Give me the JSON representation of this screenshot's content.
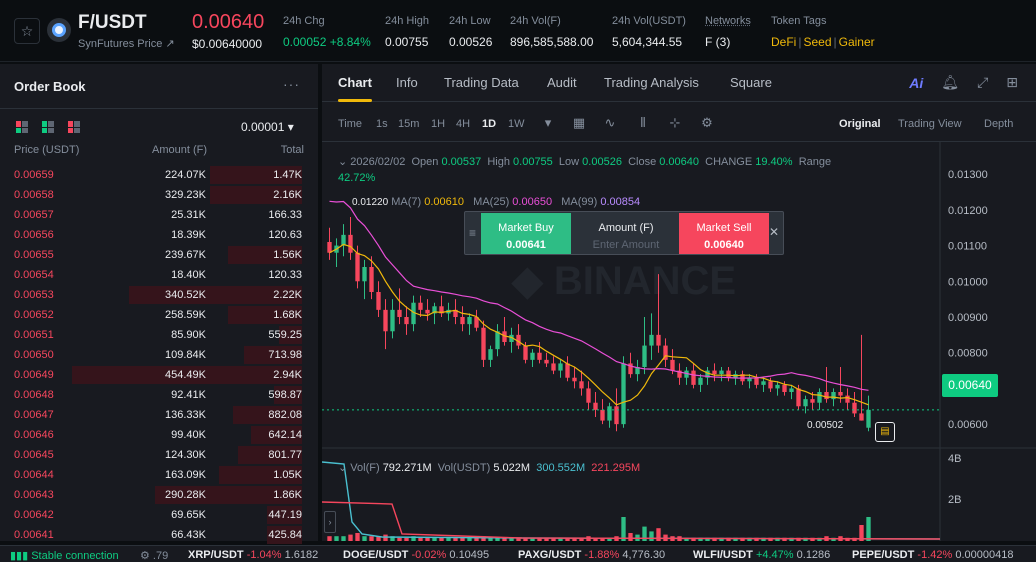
{
  "header": {
    "pair": "F/USDT",
    "source": "SynFutures Price ↗",
    "last_price": "0.00640",
    "last_price_usd": "$0.00640000",
    "stats": [
      {
        "label": "24h Chg",
        "value": "0.00052 +8.84%",
        "color": "green"
      },
      {
        "label": "24h High",
        "value": "0.00755"
      },
      {
        "label": "24h Low",
        "value": "0.00526"
      },
      {
        "label": "24h Vol(F)",
        "value": "896,585,588.00"
      },
      {
        "label": "24h Vol(USDT)",
        "value": "5,604,344.55"
      },
      {
        "label": "Networks",
        "value": "F (3)"
      }
    ],
    "token_tags_label": "Token Tags",
    "token_tags": [
      "DeFi",
      "Seed",
      "Gainer"
    ]
  },
  "orderbook": {
    "title": "Order Book",
    "precision": "0.00001 ▾",
    "col_price": "Price (USDT)",
    "col_amount": "Amount (F)",
    "col_total": "Total",
    "rows": [
      {
        "price": "0.00659",
        "amount": "224.07K",
        "total": "1.47K",
        "depth": 0.4
      },
      {
        "price": "0.00658",
        "amount": "329.23K",
        "total": "2.16K",
        "depth": 0.4
      },
      {
        "price": "0.00657",
        "amount": "25.31K",
        "total": "166.33",
        "depth": 0.0
      },
      {
        "price": "0.00656",
        "amount": "18.39K",
        "total": "120.63",
        "depth": 0.0
      },
      {
        "price": "0.00655",
        "amount": "239.67K",
        "total": "1.56K",
        "depth": 0.32
      },
      {
        "price": "0.00654",
        "amount": "18.40K",
        "total": "120.33",
        "depth": 0.0
      },
      {
        "price": "0.00653",
        "amount": "340.52K",
        "total": "2.22K",
        "depth": 0.75
      },
      {
        "price": "0.00652",
        "amount": "258.59K",
        "total": "1.68K",
        "depth": 0.32
      },
      {
        "price": "0.00651",
        "amount": "85.90K",
        "total": "559.25",
        "depth": 0.1
      },
      {
        "price": "0.00650",
        "amount": "109.84K",
        "total": "713.98",
        "depth": 0.25
      },
      {
        "price": "0.00649",
        "amount": "454.49K",
        "total": "2.94K",
        "depth": 1.0
      },
      {
        "price": "0.00648",
        "amount": "92.41K",
        "total": "598.87",
        "depth": 0.12
      },
      {
        "price": "0.00647",
        "amount": "136.33K",
        "total": "882.08",
        "depth": 0.3
      },
      {
        "price": "0.00646",
        "amount": "99.40K",
        "total": "642.14",
        "depth": 0.22
      },
      {
        "price": "0.00645",
        "amount": "124.30K",
        "total": "801.77",
        "depth": 0.28
      },
      {
        "price": "0.00644",
        "amount": "163.09K",
        "total": "1.05K",
        "depth": 0.36
      },
      {
        "price": "0.00643",
        "amount": "290.28K",
        "total": "1.86K",
        "depth": 0.64
      },
      {
        "price": "0.00642",
        "amount": "69.65K",
        "total": "447.19",
        "depth": 0.15
      },
      {
        "price": "0.00641",
        "amount": "66.43K",
        "total": "425.84",
        "depth": 0.15
      }
    ]
  },
  "chart_tabs": [
    "Chart",
    "Info",
    "Trading Data",
    "Audit",
    "Trading Analysis",
    "Square"
  ],
  "timeframes": [
    "Time",
    "1s",
    "15m",
    "1H",
    "4H",
    "1D",
    "1W"
  ],
  "active_timeframe": "1D",
  "view_modes": [
    "Original",
    "Trading View",
    "Depth"
  ],
  "ohlc": {
    "date": "2026/02/02",
    "open_label": "Open",
    "open": "0.00537",
    "high_label": "High",
    "high": "0.00755",
    "low_label": "Low",
    "low": "0.00526",
    "close_label": "Close",
    "close": "0.00640",
    "change_label": "CHANGE",
    "change": "19.40%",
    "range_label": "Range",
    "range": "42.72%"
  },
  "ma": {
    "ma7_label": "MA(7)",
    "ma7": "0.00610",
    "ma25_label": "MA(25)",
    "ma25": "0.00650",
    "ma99_label": "MA(99)",
    "ma99": "0.00854",
    "cursor_price": "0.01220"
  },
  "trade_popup": {
    "buy_label": "Market Buy",
    "buy_price": "0.00641",
    "amount_label": "Amount (F)",
    "amount_placeholder": "Enter Amount",
    "sell_label": "Market Sell",
    "sell_price": "0.00640"
  },
  "watermark": "BINANCE",
  "price_tag": "0.00640",
  "low_marker": "0.00502",
  "volume": {
    "vol_label": "Vol(F)",
    "vol_value": "792.271M",
    "usdt_label": "Vol(USDT)",
    "usdt_value": "5.022M",
    "ma1": "300.552M",
    "ma2": "221.295M"
  },
  "chart_data": {
    "type": "candlestick",
    "y_ticks": [
      "0.01300",
      "0.01200",
      "0.01100",
      "0.01000",
      "0.00900",
      "0.00800",
      "0.00700",
      "0.00600"
    ],
    "ylim": [
      0.0055,
      0.0139
    ],
    "vol_ticks": [
      "4B",
      "2B"
    ],
    "candles": [
      {
        "o": 0.0111,
        "h": 0.0115,
        "l": 0.0106,
        "c": 0.0108
      },
      {
        "o": 0.0108,
        "h": 0.0112,
        "l": 0.0104,
        "c": 0.011
      },
      {
        "o": 0.011,
        "h": 0.0116,
        "l": 0.0107,
        "c": 0.0113
      },
      {
        "o": 0.0113,
        "h": 0.0118,
        "l": 0.0106,
        "c": 0.0108
      },
      {
        "o": 0.0108,
        "h": 0.011,
        "l": 0.0098,
        "c": 0.01
      },
      {
        "o": 0.01,
        "h": 0.0106,
        "l": 0.0095,
        "c": 0.0104
      },
      {
        "o": 0.0104,
        "h": 0.0107,
        "l": 0.0095,
        "c": 0.0097
      },
      {
        "o": 0.0097,
        "h": 0.01,
        "l": 0.009,
        "c": 0.0092
      },
      {
        "o": 0.0092,
        "h": 0.0095,
        "l": 0.0081,
        "c": 0.0086
      },
      {
        "o": 0.0086,
        "h": 0.0095,
        "l": 0.0084,
        "c": 0.0092
      },
      {
        "o": 0.0092,
        "h": 0.0098,
        "l": 0.0088,
        "c": 0.009
      },
      {
        "o": 0.009,
        "h": 0.0093,
        "l": 0.0085,
        "c": 0.0088
      },
      {
        "o": 0.0088,
        "h": 0.0096,
        "l": 0.0086,
        "c": 0.0094
      },
      {
        "o": 0.0094,
        "h": 0.0096,
        "l": 0.009,
        "c": 0.0092
      },
      {
        "o": 0.0092,
        "h": 0.0095,
        "l": 0.0089,
        "c": 0.0091
      },
      {
        "o": 0.0091,
        "h": 0.0094,
        "l": 0.0088,
        "c": 0.0093
      },
      {
        "o": 0.0093,
        "h": 0.0096,
        "l": 0.009,
        "c": 0.0091
      },
      {
        "o": 0.0091,
        "h": 0.0094,
        "l": 0.0089,
        "c": 0.0092
      },
      {
        "o": 0.0092,
        "h": 0.0095,
        "l": 0.0088,
        "c": 0.009
      },
      {
        "o": 0.009,
        "h": 0.0093,
        "l": 0.0086,
        "c": 0.0088
      },
      {
        "o": 0.0088,
        "h": 0.0091,
        "l": 0.0085,
        "c": 0.009
      },
      {
        "o": 0.009,
        "h": 0.0092,
        "l": 0.0086,
        "c": 0.0087
      },
      {
        "o": 0.0087,
        "h": 0.0089,
        "l": 0.0076,
        "c": 0.0078
      },
      {
        "o": 0.0078,
        "h": 0.0082,
        "l": 0.0076,
        "c": 0.0081
      },
      {
        "o": 0.0081,
        "h": 0.0088,
        "l": 0.0079,
        "c": 0.0086
      },
      {
        "o": 0.0086,
        "h": 0.009,
        "l": 0.0082,
        "c": 0.0083
      },
      {
        "o": 0.0083,
        "h": 0.0087,
        "l": 0.008,
        "c": 0.0085
      },
      {
        "o": 0.0085,
        "h": 0.0088,
        "l": 0.0081,
        "c": 0.0082
      },
      {
        "o": 0.0082,
        "h": 0.0083,
        "l": 0.0077,
        "c": 0.0078
      },
      {
        "o": 0.0078,
        "h": 0.0081,
        "l": 0.0076,
        "c": 0.008
      },
      {
        "o": 0.008,
        "h": 0.0083,
        "l": 0.0077,
        "c": 0.0078
      },
      {
        "o": 0.0078,
        "h": 0.008,
        "l": 0.0076,
        "c": 0.0077
      },
      {
        "o": 0.0077,
        "h": 0.0079,
        "l": 0.0074,
        "c": 0.0075
      },
      {
        "o": 0.0075,
        "h": 0.0078,
        "l": 0.0073,
        "c": 0.0077
      },
      {
        "o": 0.0077,
        "h": 0.0079,
        "l": 0.0072,
        "c": 0.0073
      },
      {
        "o": 0.0073,
        "h": 0.0076,
        "l": 0.007,
        "c": 0.0072
      },
      {
        "o": 0.0072,
        "h": 0.0075,
        "l": 0.0068,
        "c": 0.007
      },
      {
        "o": 0.007,
        "h": 0.0072,
        "l": 0.0064,
        "c": 0.0066
      },
      {
        "o": 0.0066,
        "h": 0.0069,
        "l": 0.0062,
        "c": 0.0064
      },
      {
        "o": 0.0064,
        "h": 0.0067,
        "l": 0.006,
        "c": 0.0061
      },
      {
        "o": 0.0061,
        "h": 0.0066,
        "l": 0.0059,
        "c": 0.0065
      },
      {
        "o": 0.0065,
        "h": 0.007,
        "l": 0.0058,
        "c": 0.006
      },
      {
        "o": 0.006,
        "h": 0.0079,
        "l": 0.0059,
        "c": 0.0077
      },
      {
        "o": 0.0077,
        "h": 0.008,
        "l": 0.0073,
        "c": 0.0074
      },
      {
        "o": 0.0074,
        "h": 0.0078,
        "l": 0.0072,
        "c": 0.0076
      },
      {
        "o": 0.0076,
        "h": 0.009,
        "l": 0.0074,
        "c": 0.0082
      },
      {
        "o": 0.0082,
        "h": 0.0091,
        "l": 0.0078,
        "c": 0.0085
      },
      {
        "o": 0.0085,
        "h": 0.0102,
        "l": 0.008,
        "c": 0.0082
      },
      {
        "o": 0.0082,
        "h": 0.0084,
        "l": 0.0076,
        "c": 0.0078
      },
      {
        "o": 0.0078,
        "h": 0.0081,
        "l": 0.0074,
        "c": 0.0075
      },
      {
        "o": 0.0075,
        "h": 0.0077,
        "l": 0.0071,
        "c": 0.0073
      },
      {
        "o": 0.0073,
        "h": 0.0076,
        "l": 0.0071,
        "c": 0.0075
      },
      {
        "o": 0.0075,
        "h": 0.0077,
        "l": 0.007,
        "c": 0.0071
      },
      {
        "o": 0.0071,
        "h": 0.0074,
        "l": 0.0069,
        "c": 0.0073
      },
      {
        "o": 0.0073,
        "h": 0.0076,
        "l": 0.0071,
        "c": 0.0075
      },
      {
        "o": 0.0075,
        "h": 0.0077,
        "l": 0.0072,
        "c": 0.0074
      },
      {
        "o": 0.0074,
        "h": 0.0076,
        "l": 0.0072,
        "c": 0.0075
      },
      {
        "o": 0.0075,
        "h": 0.0076,
        "l": 0.0072,
        "c": 0.0073
      },
      {
        "o": 0.0073,
        "h": 0.0075,
        "l": 0.0071,
        "c": 0.0074
      },
      {
        "o": 0.0074,
        "h": 0.0075,
        "l": 0.0071,
        "c": 0.0072
      },
      {
        "o": 0.0072,
        "h": 0.0074,
        "l": 0.007,
        "c": 0.0073
      },
      {
        "o": 0.0073,
        "h": 0.0074,
        "l": 0.007,
        "c": 0.0071
      },
      {
        "o": 0.0071,
        "h": 0.0073,
        "l": 0.0069,
        "c": 0.0072
      },
      {
        "o": 0.0072,
        "h": 0.0073,
        "l": 0.0069,
        "c": 0.007
      },
      {
        "o": 0.007,
        "h": 0.0072,
        "l": 0.0068,
        "c": 0.0071
      },
      {
        "o": 0.0071,
        "h": 0.0072,
        "l": 0.0068,
        "c": 0.0069
      },
      {
        "o": 0.0069,
        "h": 0.0071,
        "l": 0.0067,
        "c": 0.007
      },
      {
        "o": 0.007,
        "h": 0.0071,
        "l": 0.0064,
        "c": 0.0065
      },
      {
        "o": 0.0065,
        "h": 0.0068,
        "l": 0.0063,
        "c": 0.0067
      },
      {
        "o": 0.0067,
        "h": 0.0069,
        "l": 0.0064,
        "c": 0.0066
      },
      {
        "o": 0.0066,
        "h": 0.007,
        "l": 0.0064,
        "c": 0.0069
      },
      {
        "o": 0.0069,
        "h": 0.0076,
        "l": 0.0066,
        "c": 0.0067
      },
      {
        "o": 0.0067,
        "h": 0.007,
        "l": 0.0065,
        "c": 0.0069
      },
      {
        "o": 0.0069,
        "h": 0.0076,
        "l": 0.0066,
        "c": 0.0068
      },
      {
        "o": 0.0068,
        "h": 0.007,
        "l": 0.0064,
        "c": 0.0066
      },
      {
        "o": 0.0066,
        "h": 0.0069,
        "l": 0.0062,
        "c": 0.0063
      },
      {
        "o": 0.0063,
        "h": 0.0085,
        "l": 0.0061,
        "c": 0.0061
      },
      {
        "o": 0.0059,
        "h": 0.0068,
        "l": 0.0058,
        "c": 0.0064
      }
    ],
    "volumes": [
      0.03,
      0.03,
      0.03,
      0.04,
      0.05,
      0.03,
      0.03,
      0.03,
      0.04,
      0.03,
      0.02,
      0.02,
      0.03,
      0.02,
      0.02,
      0.02,
      0.02,
      0.02,
      0.02,
      0.02,
      0.02,
      0.02,
      0.03,
      0.02,
      0.02,
      0.02,
      0.02,
      0.02,
      0.02,
      0.02,
      0.02,
      0.02,
      0.02,
      0.02,
      0.02,
      0.02,
      0.02,
      0.03,
      0.02,
      0.02,
      0.02,
      0.03,
      0.15,
      0.05,
      0.04,
      0.09,
      0.06,
      0.08,
      0.04,
      0.03,
      0.03,
      0.02,
      0.02,
      0.02,
      0.02,
      0.02,
      0.02,
      0.02,
      0.02,
      0.02,
      0.02,
      0.02,
      0.02,
      0.02,
      0.02,
      0.02,
      0.02,
      0.02,
      0.02,
      0.02,
      0.02,
      0.03,
      0.02,
      0.03,
      0.02,
      0.02,
      0.1,
      0.15
    ]
  },
  "bottom_bar": {
    "connection": "Stable connection",
    "speed": ".79",
    "tickers": [
      {
        "name": "XRP/USDT",
        "chg": "-1.04%",
        "price": "1.6182",
        "dir": "down"
      },
      {
        "name": "DOGE/USDT",
        "chg": "-0.02%",
        "price": "0.10495",
        "dir": "down"
      },
      {
        "name": "PAXG/USDT",
        "chg": "-1.88%",
        "price": "4,776.30",
        "dir": "down"
      },
      {
        "name": "WLFI/USDT",
        "chg": "+4.47%",
        "price": "0.1286",
        "dir": "up"
      },
      {
        "name": "PEPE/USDT",
        "chg": "-1.42%",
        "price": "0.00000418",
        "dir": "down"
      }
    ]
  },
  "colors": {
    "up": "#2ebd85",
    "down": "#f6465d",
    "ma7": "#f0b90b",
    "ma25": "#e94fd7",
    "accent": "#f0b90b"
  }
}
